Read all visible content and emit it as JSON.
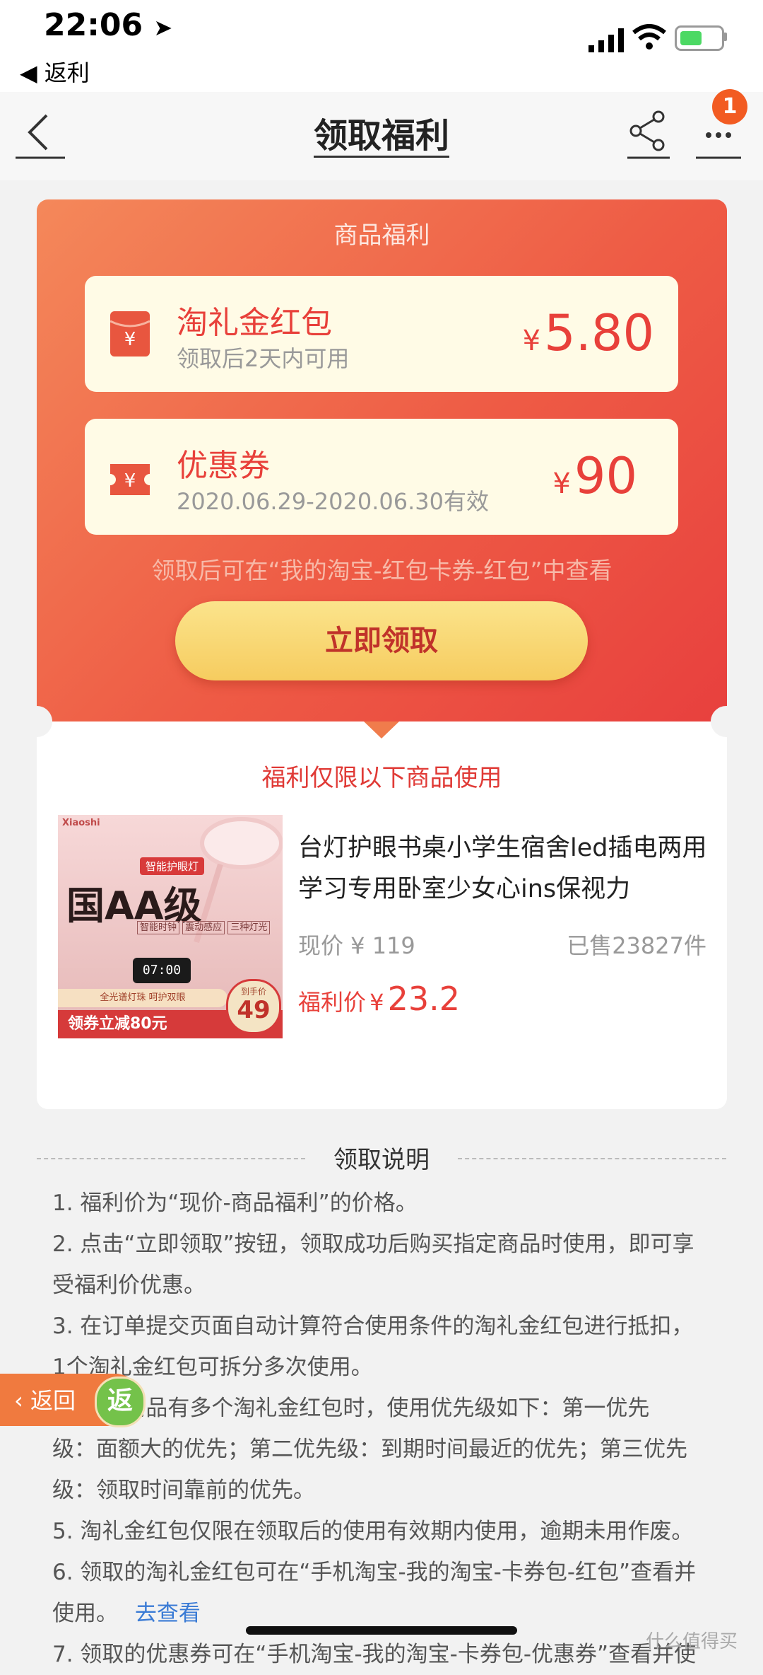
{
  "status": {
    "time": "22:06",
    "back_app": "◀ 返利"
  },
  "nav": {
    "title": "领取福利",
    "badge": "1"
  },
  "welfare": {
    "section_title": "商品福利",
    "coupons": [
      {
        "name": "淘礼金红包",
        "sub": "领取后2天内可用",
        "currency": "¥",
        "amount": "5.80"
      },
      {
        "name": "优惠券",
        "sub": "2020.06.29-2020.06.30有效",
        "currency": "¥",
        "amount": "90"
      }
    ],
    "hint": "领取后可在“我的淘宝-红包卡券-红包”中查看",
    "claim_button": "立即领取"
  },
  "product": {
    "limit_text": "福利仅限以下商品使用",
    "title": "台灯护眼书桌小学生宿舍led插电两用学习专用卧室少女心ins保视力",
    "now_price": "现价 ¥ 119",
    "sold": "已售23827件",
    "welfare_label": "福利价",
    "welfare_currency": "¥",
    "welfare_price": "23.2",
    "image": {
      "brand": "Xiaoshi",
      "tag": "智能护眼灯",
      "headline": "国AA级",
      "features": [
        "智能时钟",
        "震动感应",
        "三种灯光"
      ],
      "clock": "07:00",
      "bead": "全光谱灯珠 呵护双眼",
      "promo": "领券立减80元",
      "hand_price_label": "到手价",
      "hand_price": "49"
    }
  },
  "instructions": {
    "title": "领取说明",
    "lines": [
      "1. 福利价为“现价-商品福利”的价格。",
      "2. 点击“立即领取”按钮，领取成功后购买指定商品时使用，即可享",
      "受福利价优惠。",
      "3. 在订单提交页面自动计算符合使用条件的淘礼金红包进行抵扣，",
      "1个淘礼金红包可拆分多次使用。",
      "4. 同一商品有多个淘礼金红包时，使用优先级如下：第一优先",
      "级：面额大的优先；第二优先级：到期时间最近的优先；第三优先",
      "级：领取时间靠前的优先。",
      "5. 淘礼金红包仅限在领取后的使用有效期内使用，逾期未用作废。",
      "6. 领取的淘礼金红包可在“手机淘宝-我的淘宝-卡券包-红包”查看并",
      "使用。",
      "7. 领取的优惠券可在“手机淘宝-我的淘宝-卡券包-优惠券”查看并使"
    ],
    "link": "去查看"
  },
  "float_return": {
    "label": "返回",
    "icon_text": "返"
  },
  "watermark": "什么值得买",
  "colors": {
    "accent": "#e8403a",
    "card_start": "#f4885a",
    "card_end": "#e8403e",
    "button": "#f6cc5f"
  }
}
